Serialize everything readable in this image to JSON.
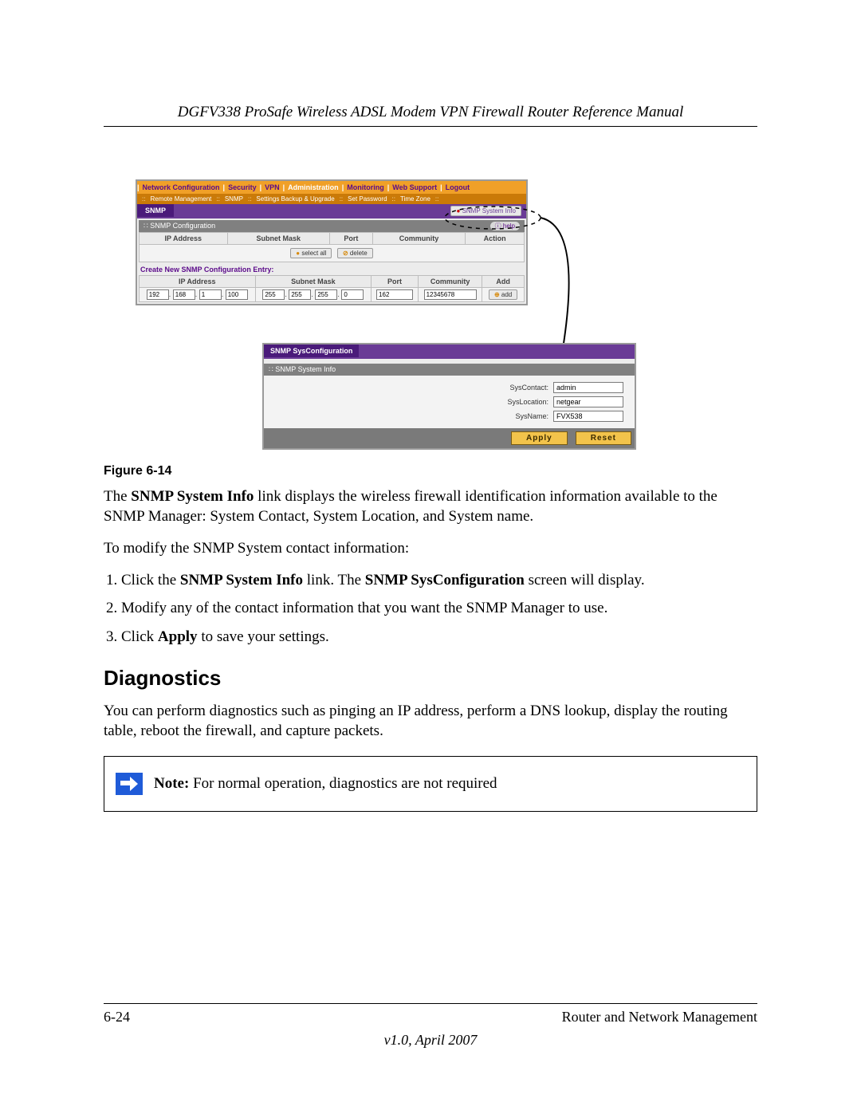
{
  "header": "DGFV338 ProSafe Wireless ADSL Modem VPN Firewall Router Reference Manual",
  "router_top": {
    "nav1": [
      "Network Configuration",
      "Security",
      "VPN",
      "Administration",
      "Monitoring",
      "Web Support",
      "Logout"
    ],
    "nav1_active_index": 3,
    "nav2": [
      "Remote Management",
      "SNMP",
      "Settings Backup & Upgrade",
      "Set Password",
      "Time Zone"
    ],
    "tab": "SNMP",
    "link_label": "SNMP System Info",
    "section1_title": "SNMP Configuration",
    "help_label": "help",
    "table_headers": [
      "IP Address",
      "Subnet Mask",
      "Port",
      "Community",
      "Action"
    ],
    "btn_select_all": "select all",
    "btn_delete": "delete",
    "create_label": "Create New SNMP Configuration Entry:",
    "entry_headers": [
      "IP Address",
      "Subnet Mask",
      "Port",
      "Community",
      "Add"
    ],
    "entry": {
      "ip": [
        "192",
        "168",
        "1",
        "100"
      ],
      "mask": [
        "255",
        "255",
        "255",
        "0"
      ],
      "port": "162",
      "community": "12345678",
      "add_label": "add"
    }
  },
  "router_bot": {
    "tab": "SNMP SysConfiguration",
    "section_title": "SNMP System Info",
    "fields": {
      "sys_contact_label": "SysContact:",
      "sys_contact_value": "admin",
      "sys_location_label": "SysLocation:",
      "sys_location_value": "netgear",
      "sys_name_label": "SysName:",
      "sys_name_value": "FVX538"
    },
    "btn_apply": "Apply",
    "btn_reset": "Reset"
  },
  "figure_label": "Figure 6-14",
  "para1_pre": "The ",
  "para1_bold": "SNMP System Info",
  "para1_post": " link displays the wireless firewall identification information available to the SNMP Manager: System Contact, System Location, and System name.",
  "para2": "To modify the SNMP System contact information:",
  "steps": {
    "s1_a": "Click the ",
    "s1_b1": "SNMP System Info",
    "s1_c": " link. The ",
    "s1_b2": "SNMP SysConfiguration",
    "s1_d": " screen will display.",
    "s2": "Modify any of the contact information that you want the SNMP Manager to use.",
    "s3_a": "Click ",
    "s3_b": "Apply",
    "s3_c": " to save your settings."
  },
  "h2": "Diagnostics",
  "para3": "You can perform diagnostics such as pinging an IP address, perform a DNS lookup, display the routing table, reboot the firewall, and capture packets.",
  "note_bold": "Note:",
  "note_text": " For normal operation, diagnostics are not required",
  "footer": {
    "page": "6-24",
    "chapter": "Router and Network Management",
    "version": "v1.0, April 2007"
  }
}
